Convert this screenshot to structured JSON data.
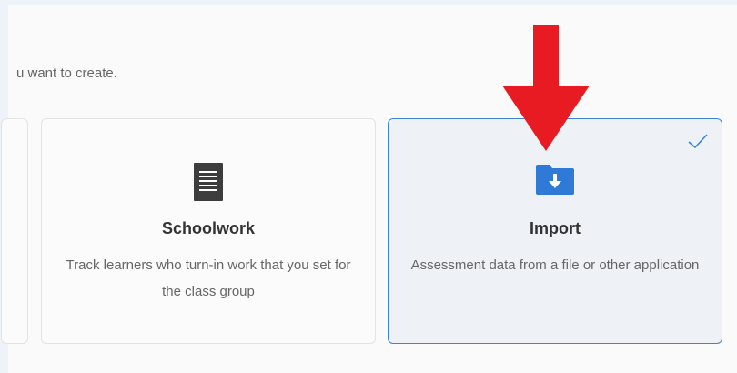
{
  "intro_text": "u want to create.",
  "cards": [
    {
      "title": "Schoolwork",
      "description": "Track learners who turn-in work that you set for the class group",
      "icon": "document-icon",
      "selected": false
    },
    {
      "title": "Import",
      "description": "Assessment data from a file or other application",
      "icon": "folder-download-icon",
      "selected": true
    }
  ],
  "colors": {
    "accent": "#3a85d6",
    "arrow": "#e81b23",
    "selected_bg": "#eef2f7",
    "icon_dark": "#3d3d3d",
    "folder": "#2e7ad6"
  },
  "annotation": "red-down-arrow"
}
